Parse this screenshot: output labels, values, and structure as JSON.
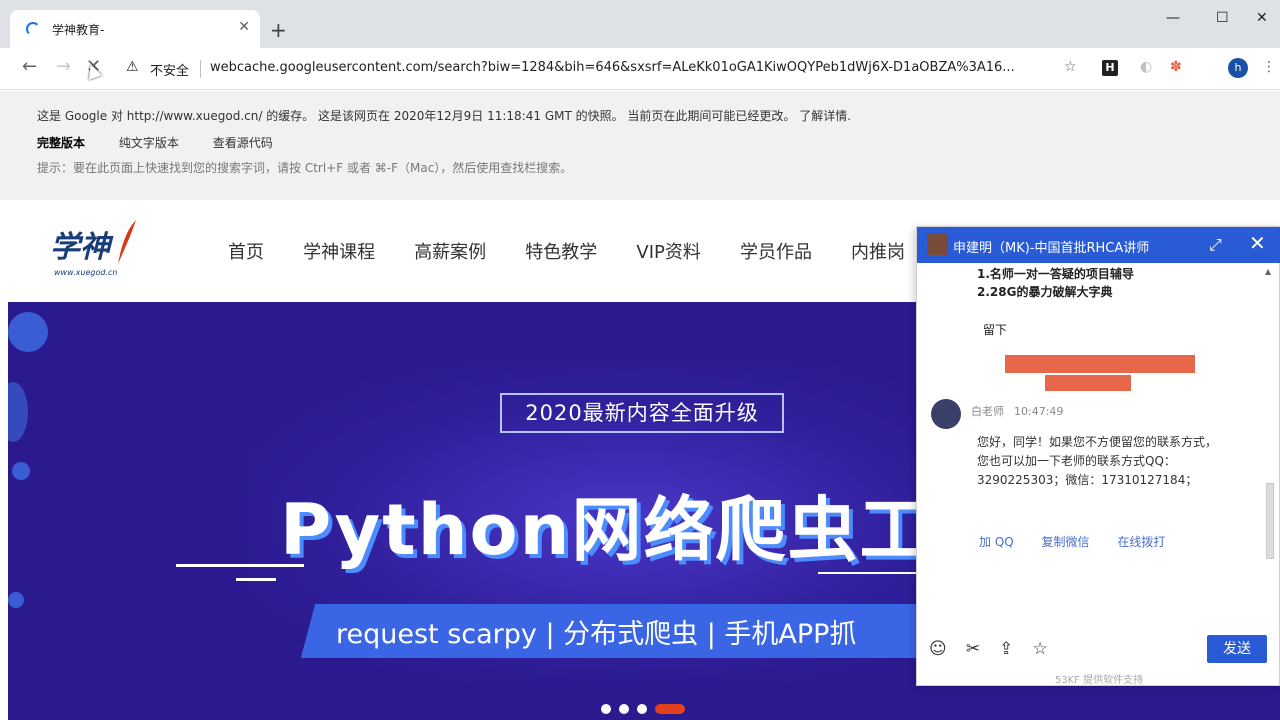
{
  "browser": {
    "tab_title": "学神教育-",
    "new_tab": "+",
    "tab_close": "✕",
    "window_controls": {
      "minimize": "—",
      "maximize": "☐",
      "close": "✕"
    },
    "omnibox": {
      "security_label": "不安全",
      "url": "webcache.googleusercontent.com/search?biw=1284&bih=646&sxsrf=ALeKk01oGA1KiwOQYPeb1dWj6X-D1aOBZA%3A16..."
    },
    "profile_initial": "h",
    "extension_h": "H"
  },
  "cache_banner": {
    "notice": "这是 Google 对 http://www.xuegod.cn/ 的缓存。 这是该网页在 2020年12月9日 11:18:41 GMT 的快照。 当前页在此期间可能已经更改。",
    "learn_more": "了解详情.",
    "links": [
      "完整版本",
      "纯文字版本",
      "查看源代码"
    ],
    "tip": "提示：要在此页面上快速找到您的搜索字词，请按 Ctrl+F 或者 ⌘-F（Mac），然后使用查找栏搜索。"
  },
  "site": {
    "logo_text": "学神",
    "logo_sub": "www.xuegod.cn",
    "nav": [
      "首页",
      "学神课程",
      "高薪案例",
      "特色教学",
      "VIP资料",
      "学员作品",
      "内推岗"
    ]
  },
  "hero": {
    "badge": "2020最新内容全面升级",
    "title": "Python网络爬虫工程",
    "subtitle": "request scarpy  |  分布式爬虫  |  手机APP抓",
    "dots_active_index": 3,
    "colors": {
      "background": "#2b1a8f",
      "accent": "#3a66e6",
      "active_dot": "#e2401e"
    }
  },
  "chat": {
    "header_name": "申建明（MK)-中国首批RHCA讲师",
    "features": [
      "1.名师一对一答疑的项目辅导",
      "2.28G的暴力破解大字典"
    ],
    "leave_prefix": "留下",
    "sender": "白老师",
    "time": "10:47:49",
    "message": "您好，同学！如果您不方便留您的联系方式，您也可以加一下老师的联系方式QQ：3290225303；微信：17310127184；",
    "actions": [
      "加 QQ",
      "复制微信",
      "在线拨打"
    ],
    "send_label": "发送",
    "footer": "53KF 提供软件支持",
    "accent_color": "#2a5bd7"
  }
}
